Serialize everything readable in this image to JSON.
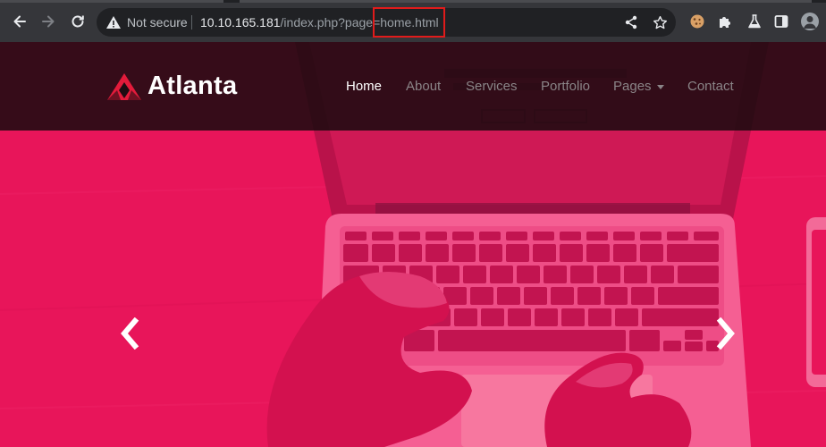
{
  "browser": {
    "security_label": "Not secure",
    "url_host": "10.10.165.181",
    "url_path": "/index.php?page=home.html",
    "icons": [
      "back-icon",
      "forward-icon",
      "reload-icon",
      "warning-icon",
      "share-icon",
      "bookmark-star-icon",
      "cookie-icon",
      "extensions-icon",
      "labs-icon",
      "side-panel-icon",
      "profile-icon"
    ]
  },
  "site": {
    "logo_text": "Atlanta",
    "nav": {
      "home": "Home",
      "about": "About",
      "services": "Services",
      "portfolio": "Portfolio",
      "pages": "Pages",
      "contact": "Contact"
    },
    "colors": {
      "accent": "#e8155a",
      "header_bg": "#180a0e",
      "nav_active": "#ffffff",
      "nav_inactive": "#8a8487",
      "logo_red": "#e31b3b"
    }
  }
}
